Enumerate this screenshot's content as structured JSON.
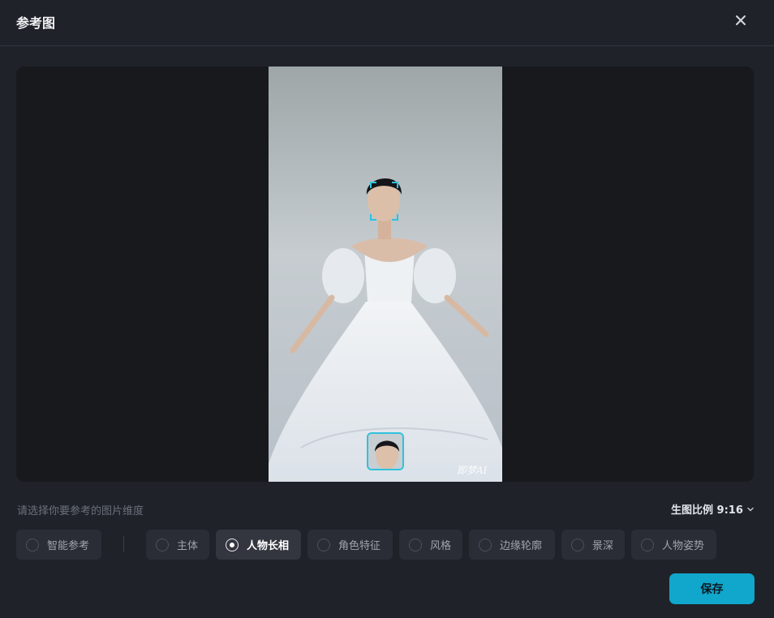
{
  "dialog": {
    "title": "参考图",
    "close_icon": "close-icon"
  },
  "preview": {
    "watermark": "即梦AI",
    "face_detection_icon": "face-bracket-icon"
  },
  "options_hint": "请选择你要参考的图片维度",
  "aspect_ratio": {
    "label": "生图比例 9:16",
    "icon": "chevron-down-icon"
  },
  "dimensions": [
    {
      "label": "智能参考",
      "selected": false
    },
    {
      "label": "主体",
      "selected": false
    },
    {
      "label": "人物长相",
      "selected": true
    },
    {
      "label": "角色特征",
      "selected": false
    },
    {
      "label": "风格",
      "selected": false
    },
    {
      "label": "边缘轮廓",
      "selected": false
    },
    {
      "label": "景深",
      "selected": false
    },
    {
      "label": "人物姿势",
      "selected": false
    }
  ],
  "save_label": "保存",
  "colors": {
    "accent": "#11a6cc",
    "face_frame": "#2fc2dd",
    "background": "#1f2229"
  }
}
